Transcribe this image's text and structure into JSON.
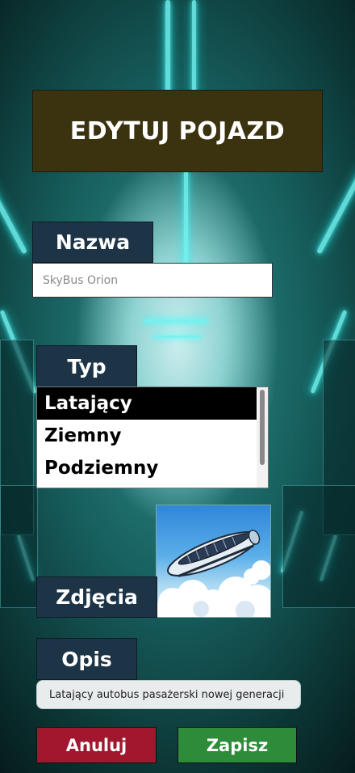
{
  "header": {
    "title": "EDYTUJ POJAZD"
  },
  "form": {
    "name_label": "Nazwa",
    "name_value": "SkyBus Orion",
    "type_label": "Typ",
    "type_options": [
      "Latający",
      "Ziemny",
      "Podziemny"
    ],
    "type_selected": "Latający",
    "photos_label": "Zdjęcia",
    "photo_icon": "flying-bus-image",
    "description_label": "Opis",
    "description_value": "Latający autobus pasażerski nowej generacji"
  },
  "actions": {
    "cancel_label": "Anuluj",
    "save_label": "Zapisz"
  },
  "colors": {
    "title_bg": "#3b3310",
    "label_bg": "#1d3446",
    "cancel_bg": "#a0172e",
    "save_bg": "#2e8b3a",
    "accent_neon": "#6ff3f0"
  }
}
